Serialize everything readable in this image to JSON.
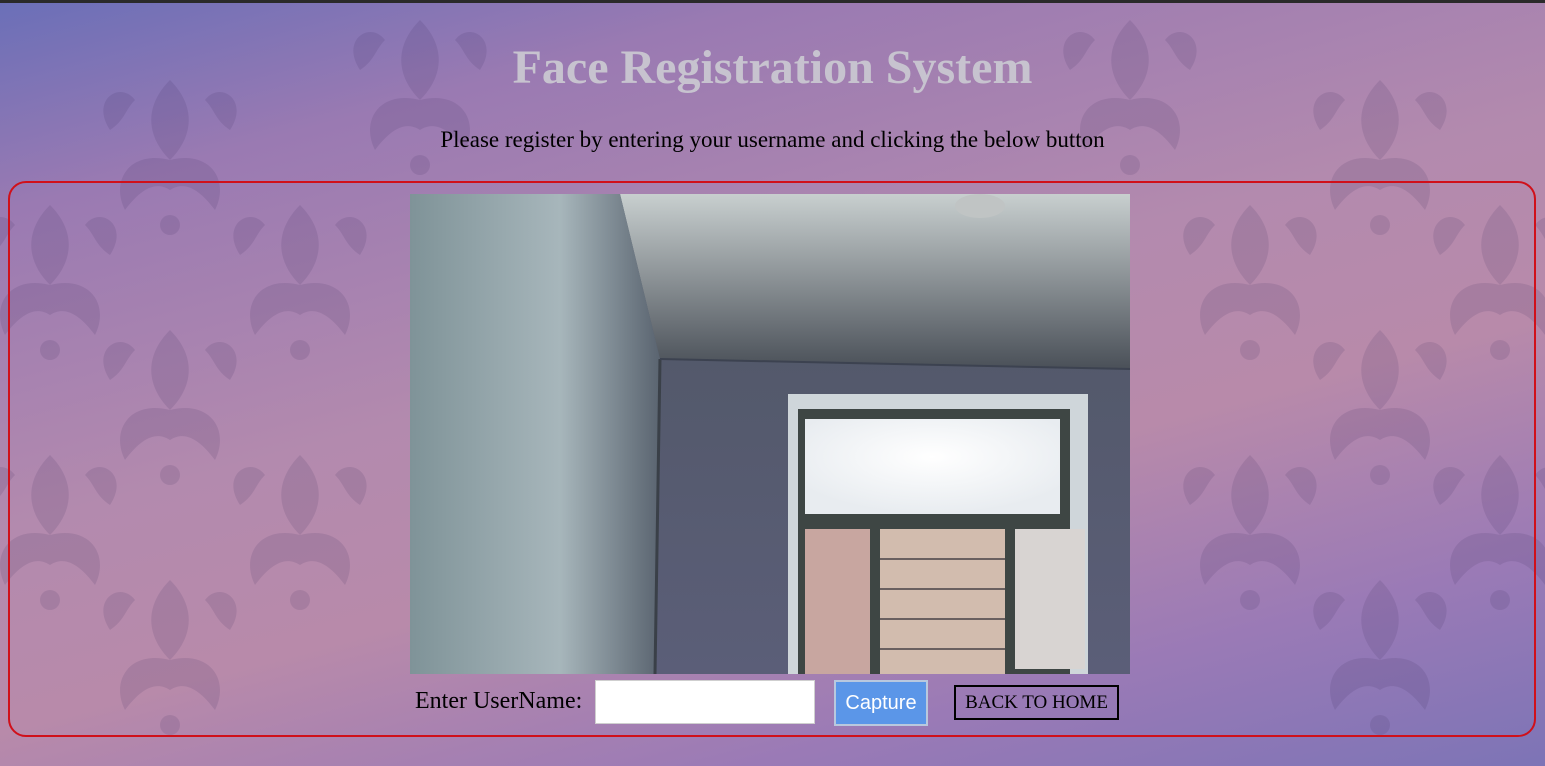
{
  "page": {
    "title": "Face Registration System",
    "subtitle": "Please register by entering your username and clicking the below button"
  },
  "form": {
    "username_label": "Enter UserName:",
    "username_value": "",
    "username_placeholder": "",
    "capture_label": "Capture",
    "back_label": "BACK TO HOME"
  },
  "colors": {
    "panel_border": "#d0101a",
    "capture_button": "#5b96e8",
    "title_text": "#c7c3cf"
  }
}
